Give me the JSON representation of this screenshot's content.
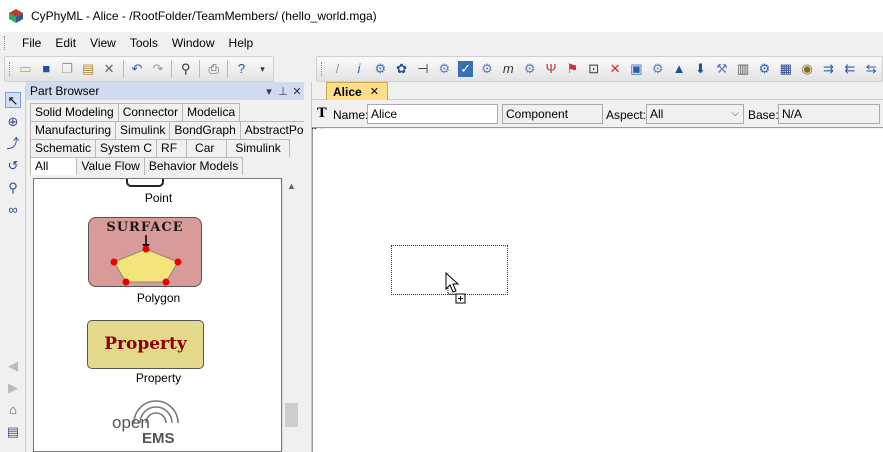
{
  "window": {
    "title": "CyPhyML - Alice - /RootFolder/TeamMembers/ (hello_world.mga)"
  },
  "menu": [
    "File",
    "Edit",
    "View",
    "Tools",
    "Window",
    "Help"
  ],
  "part_browser": {
    "title": "Part Browser",
    "tab_rows": [
      [
        "Solid Modeling",
        "Connector",
        "Modelica"
      ],
      [
        "Manufacturing",
        "Simulink",
        "BondGraph",
        "AbstractPorts"
      ],
      [
        "Schematic",
        "System C",
        "RF",
        "Car",
        "Simulink"
      ],
      [
        "All",
        "Value Flow",
        "Behavior Models"
      ]
    ],
    "active_tab": "All",
    "parts": [
      {
        "label": "Point"
      },
      {
        "label": "Polygon",
        "icon_text": "SURFACE"
      },
      {
        "label": "Property",
        "icon_text": "Property"
      },
      {
        "icon_text_top": "open",
        "icon_text_bottom": "EMS"
      }
    ]
  },
  "document": {
    "tab_label": "Alice",
    "name_label": "Name:",
    "name_value": "Alice",
    "kind_value": "Component",
    "aspect_label": "Aspect:",
    "aspect_value": "All",
    "base_label": "Base:",
    "base_value": "N/A"
  },
  "colors": {
    "doc_tab": "#ffde8b",
    "panel_header": "#cfdbef",
    "property_fill": "#e2d98a",
    "property_text": "#8b0000",
    "polygon_fill": "#d99a9a",
    "pentagon_fill": "#f5e47a"
  }
}
